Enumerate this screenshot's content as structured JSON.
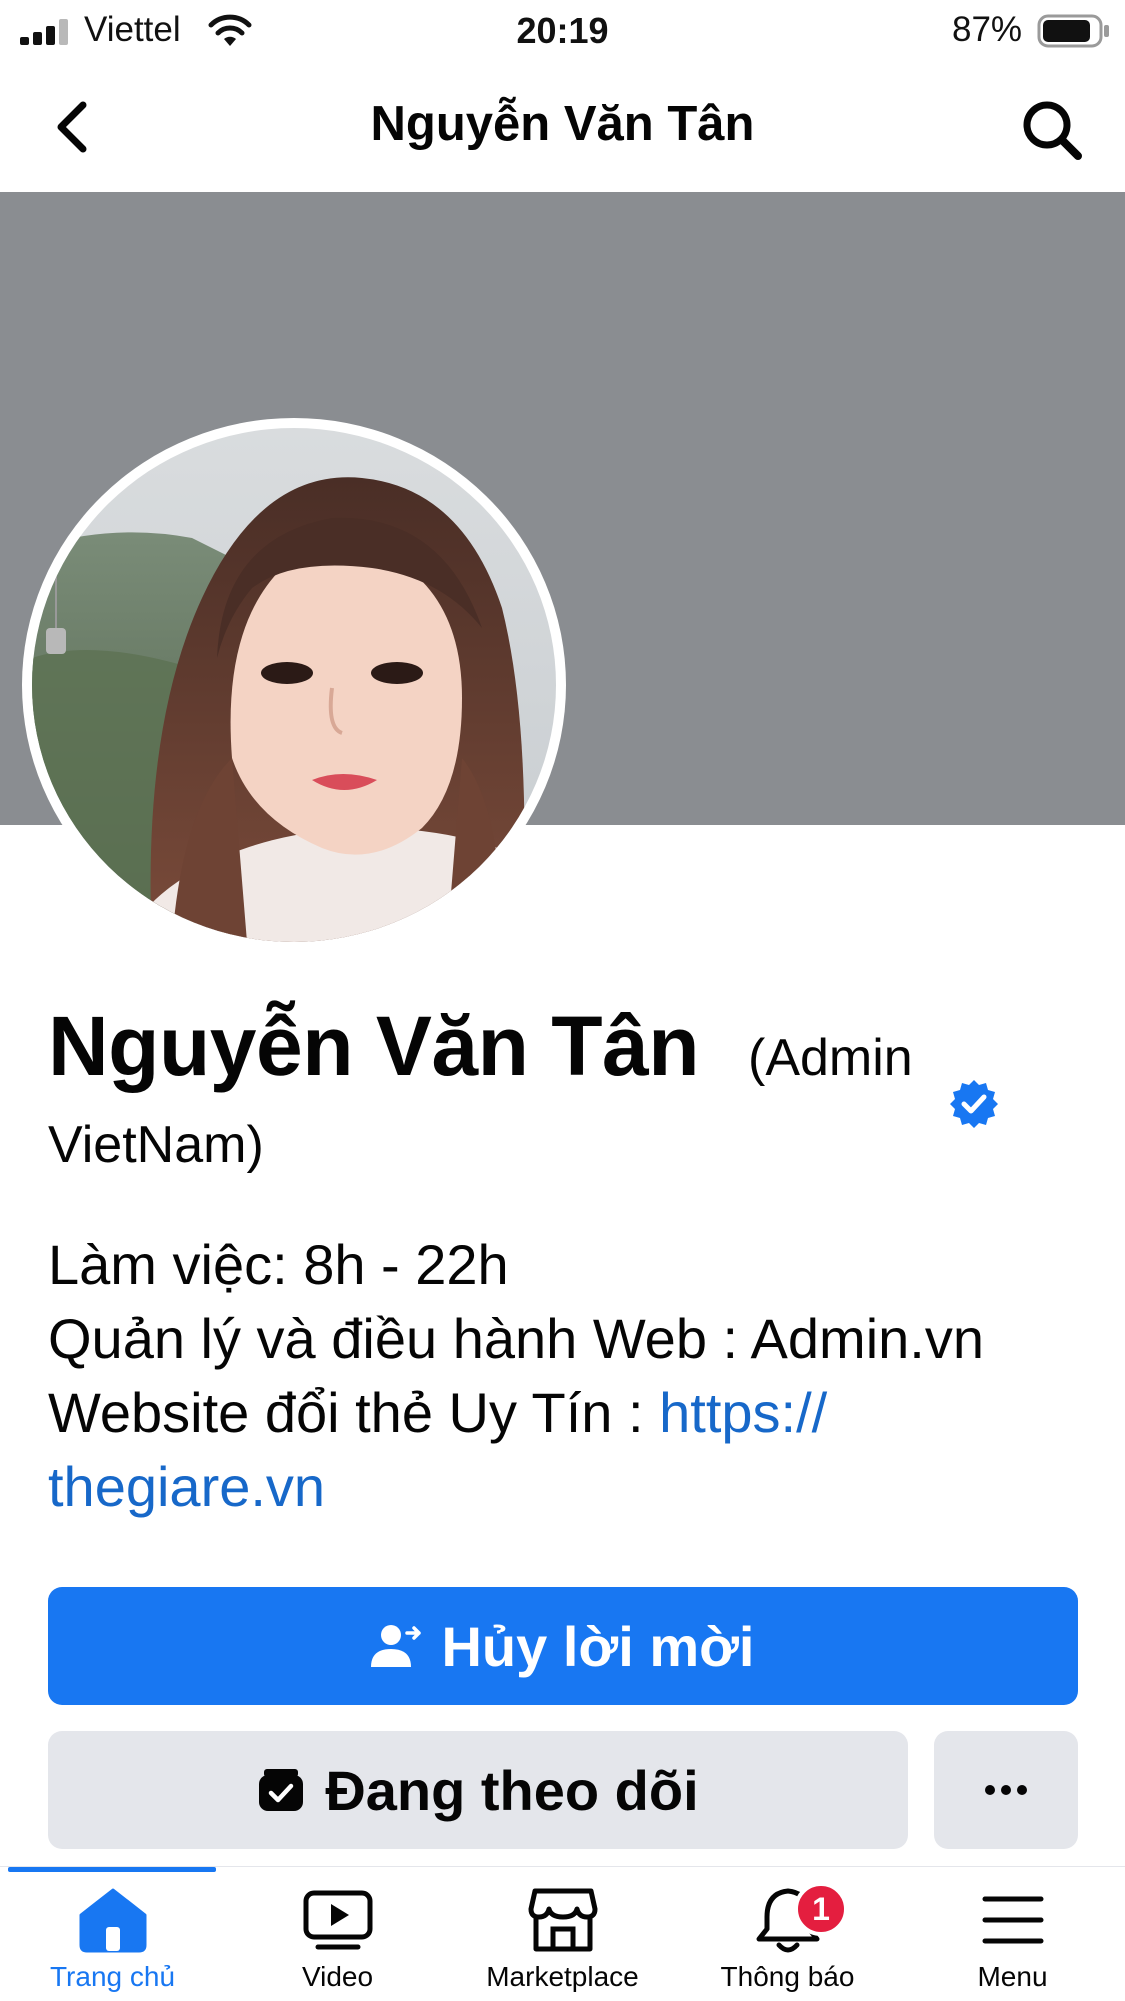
{
  "status_bar": {
    "carrier": "Viettel",
    "time": "20:19",
    "battery_percent": "87%",
    "battery_level": 0.87
  },
  "nav": {
    "title": "Nguyễn Văn Tân",
    "back_icon": "chevron-left-icon",
    "search_icon": "search-icon"
  },
  "profile": {
    "name": "Nguyễn Văn Tân",
    "name_suffix_1": "(Admin",
    "name_suffix_2": "VietNam)",
    "verified_icon": "verified-badge-icon",
    "verified_color": "#1877f2",
    "bio": {
      "line1": "Làm việc: 8h - 22h",
      "line2": "Quản lý và điều hành Web : Admin.vn",
      "line3_prefix": "Website đổi thẻ Uy Tín : ",
      "link_part1": "https://",
      "link_part2": "thegiare.vn"
    }
  },
  "actions": {
    "primary_label": "Hủy lời mời",
    "primary_icon": "person-arrow-icon",
    "secondary_label": "Đang theo dõi",
    "secondary_icon": "following-icon",
    "more_icon": "more-icon",
    "primary_color": "#1877f2",
    "secondary_color": "#e4e6eb"
  },
  "tab_bar": {
    "tabs": [
      {
        "label": "Trang chủ",
        "icon": "home-icon",
        "active": true
      },
      {
        "label": "Video",
        "icon": "video-icon",
        "active": false
      },
      {
        "label": "Marketplace",
        "icon": "marketplace-icon",
        "active": false
      },
      {
        "label": "Thông báo",
        "icon": "bell-icon",
        "active": false
      },
      {
        "label": "Menu",
        "icon": "menu-icon",
        "active": false
      }
    ],
    "notification_badge": "1",
    "accent_color": "#1877f2",
    "badge_color": "#e41e3f"
  }
}
